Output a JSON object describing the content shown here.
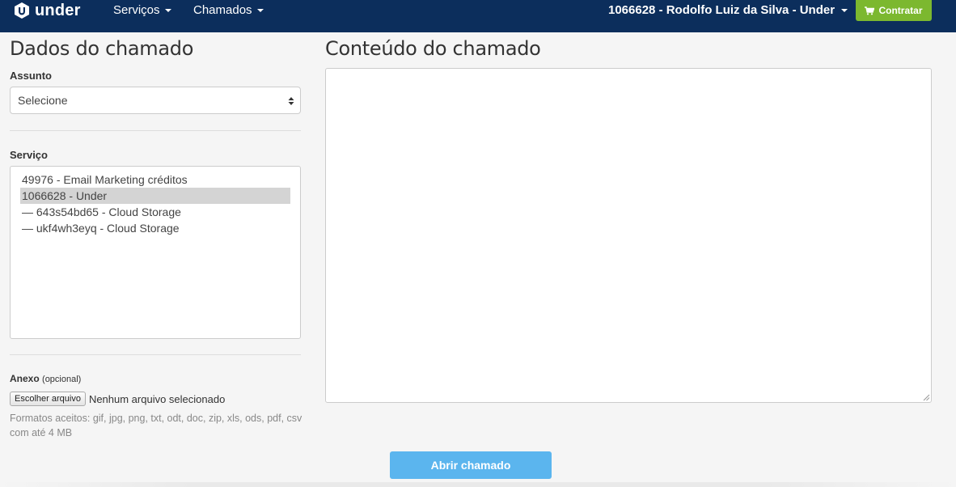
{
  "navbar": {
    "brand": "under",
    "menus": [
      {
        "label": "Serviços"
      },
      {
        "label": "Chamados"
      }
    ],
    "account": "1066628 - Rodolfo Luiz da Silva - Under",
    "contratar": "Contratar",
    "colors": {
      "background": "#0c2e5c",
      "contratar": "#7cb82f"
    }
  },
  "left": {
    "title": "Dados do chamado",
    "assunto_label": "Assunto",
    "assunto_value": "Selecione",
    "servico_label": "Serviço",
    "servico_options": [
      {
        "label": "49976 - Email Marketing créditos",
        "selected": false
      },
      {
        "label": "1066628 - Under",
        "selected": true
      },
      {
        "label": "— 643s54bd65 - Cloud Storage",
        "selected": false
      },
      {
        "label": "— ukf4wh3eyq - Cloud Storage",
        "selected": false
      }
    ],
    "anexo_label": "Anexo",
    "anexo_optional": "(opcional)",
    "file_button": "Escolher arquivo",
    "file_status": "Nenhum arquivo selecionado",
    "formats_help": "Formatos aceitos: gif, jpg, png, txt, odt, doc, zip, xls, ods, pdf, csv com até 4 MB"
  },
  "right": {
    "title": "Conteúdo do chamado",
    "content_value": ""
  },
  "submit": {
    "label": "Abrir chamado",
    "color": "#5bb5ee"
  }
}
